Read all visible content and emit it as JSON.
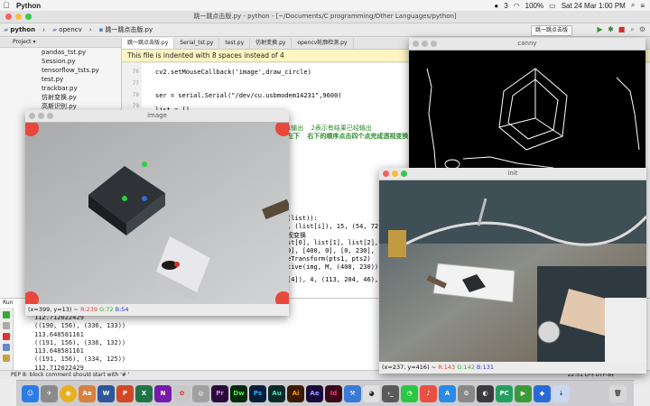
{
  "menubar": {
    "app_name": "Python",
    "right": [
      "3",
      "100%",
      "Sat 24 Mar  1:00 PM"
    ]
  },
  "ide": {
    "title": "跳一跳点击版.py - python - [~/Documents/C programming/Other Languages/python]",
    "breadcrumbs": [
      "python",
      "opencv",
      "跳一跳点击版.py"
    ],
    "run_config": "跳一跳点击版"
  },
  "project": {
    "header": "Project",
    "files": [
      "pandas_tst.py",
      "Session.py",
      "tensorflow_tsts.py",
      "test.py",
      "trackbar.py",
      "仿射变换.py",
      "高斯识别.py"
    ]
  },
  "editor": {
    "tabs": [
      "跳一跳点击版.py",
      "Serial_tst.py",
      "test.py",
      "仿射变换.py",
      "opencv轮廓检测.py"
    ],
    "notice": "This file is indented with 8 spaces instead of 4",
    "gutter": [
      "76",
      "77",
      "78",
      "79"
    ],
    "lines": [
      "cv2.setMouseCallback('image',draw_circle)",
      "ser = serial.Serial(\"/dev/cu.usbmodem14231\",9600)",
      "list = []"
    ],
    "green_lines": [
      "1输出  2表示有结果已经输出",
      "左下  右下的顺序点击四个点完成透视变换"
    ],
    "hidden_lines": [
      "(list)):",
      ", (list[i]), 15, (54, 72,",
      "视变换",
      "st[0], list[1], list[2], l",
      "0], [400, 0], [0, 230],",
      "eTransform(pts1, pts2)",
      "tive(img, M, (400, 230))",
      "[4]), 4, (113, 204, 46), -"
    ]
  },
  "run": {
    "label": "Run",
    "output": [
      "112.712022429",
      "((190, 156), (336, 133))",
      "113.648581161",
      "((191, 156), (336, 132))",
      "113.648581161",
      "((191, 156), (334, 125))",
      "112.712022429"
    ]
  },
  "status": {
    "message": "PEP 8: block comment should start with '# '",
    "position": "22:51  LF‡  UTF-8‡"
  },
  "windows": {
    "image": {
      "title": "image",
      "coords": "(x=399, y=13) ~",
      "r": "R:239",
      "g": "G:72",
      "b": "B:54"
    },
    "canny": {
      "title": "canny"
    },
    "init": {
      "title": "init",
      "coords": "(x=237, y=416) ~",
      "r": "R:143",
      "g": "G:142",
      "b": "B:131"
    }
  },
  "dock": {
    "apps": [
      "Aa",
      "W",
      "P",
      "X",
      "N",
      "Pr",
      "Dw",
      "Ps",
      "Au",
      "Ai",
      "Ae",
      "Id",
      "PC"
    ]
  }
}
